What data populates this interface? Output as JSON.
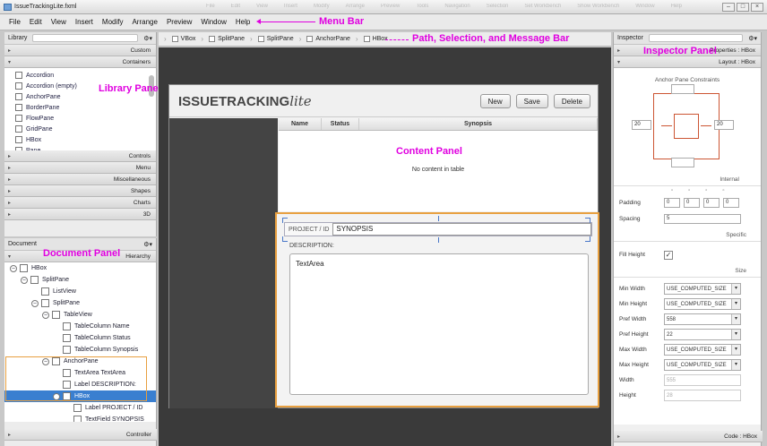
{
  "window": {
    "title": "IssueTrackingLite.fxml",
    "ghost_menu": [
      "File",
      "Edit",
      "View",
      "Insert",
      "Modify",
      "Arrange",
      "Preview",
      "Tools",
      "Navigation",
      "Selection",
      "Set Workbench",
      "Show Workbench",
      "Window",
      "Help"
    ]
  },
  "menu": [
    "File",
    "Edit",
    "View",
    "Insert",
    "Modify",
    "Arrange",
    "Preview",
    "Window",
    "Help"
  ],
  "callouts": {
    "menu_bar": "Menu Bar",
    "path_bar": "Path, Selection, and Message Bar",
    "library": "Library Panel",
    "document": "Document Panel",
    "content": "Content Panel",
    "inspector": "Inspector Panel"
  },
  "library": {
    "title": "Library",
    "top_sections": [
      "Custom",
      "Containers"
    ],
    "items": [
      "Accordion",
      "Accordion  (empty)",
      "AnchorPane",
      "BorderPane",
      "FlowPane",
      "GridPane",
      "HBox",
      "Pane"
    ],
    "bottom_sections": [
      "Controls",
      "Menu",
      "Miscellaneous",
      "Shapes",
      "Charts",
      "3D"
    ]
  },
  "document": {
    "title": "Document",
    "section": "Hierarchy",
    "tree": [
      {
        "exp": "-",
        "text": "HBox",
        "indent": 0
      },
      {
        "exp": "-",
        "text": "SplitPane",
        "indent": 1
      },
      {
        "exp": "",
        "text": "ListView",
        "indent": 2
      },
      {
        "exp": "-",
        "text": "SplitPane",
        "indent": 2
      },
      {
        "exp": "-",
        "text": "TableView",
        "indent": 3
      },
      {
        "exp": "",
        "text": "TableColumn  Name",
        "indent": 4
      },
      {
        "exp": "",
        "text": "TableColumn  Status",
        "indent": 4
      },
      {
        "exp": "",
        "text": "TableColumn  Synopsis",
        "indent": 4
      },
      {
        "exp": "-",
        "text": "AnchorPane",
        "indent": 3
      },
      {
        "exp": "",
        "text": "TextArea  TextArea",
        "indent": 4
      },
      {
        "exp": "",
        "text": "Label  DESCRIPTION:",
        "indent": 4
      },
      {
        "exp": "-",
        "text": "HBox",
        "indent": 4
      },
      {
        "exp": "",
        "text": "Label  PROJECT / ID",
        "indent": 5
      },
      {
        "exp": "",
        "text": "TextField  SYNOPSIS",
        "indent": 5
      }
    ],
    "footer": "Controller"
  },
  "breadcrumb": [
    "VBox",
    "SplitPane",
    "SplitPane",
    "AnchorPane",
    "HBox"
  ],
  "app": {
    "title_bold": "ISSUETRACKING",
    "title_light": "lite",
    "buttons": [
      "New",
      "Save",
      "Delete"
    ],
    "columns": [
      "Name",
      "Status",
      "Synopsis"
    ],
    "empty_text": "No content in table",
    "project_label": "PROJECT / ID",
    "synopsis_value": "SYNOPSIS",
    "description_label": "DESCRIPTION:",
    "textarea_value": "TextArea"
  },
  "inspector": {
    "title": "Inspector",
    "properties": "Properties : HBox",
    "layout": "Layout : HBox",
    "anchor_title": "Anchor Pane Constraints",
    "anchor_left": "20",
    "anchor_right": "20",
    "internal": "Internal",
    "padding_label": "Padding",
    "padding": [
      "0",
      "0",
      "0",
      "0"
    ],
    "spacing_label": "Spacing",
    "spacing": "5",
    "specific": "Specific",
    "fill_height_label": "Fill Height",
    "size": "Size",
    "size_rows": [
      {
        "label": "Min Width",
        "value": "USE_COMPUTED_SIZE"
      },
      {
        "label": "Min Height",
        "value": "USE_COMPUTED_SIZE"
      },
      {
        "label": "Pref Width",
        "value": "558"
      },
      {
        "label": "Pref Height",
        "value": "22"
      },
      {
        "label": "Max Width",
        "value": "USE_COMPUTED_SIZE"
      },
      {
        "label": "Max Height",
        "value": "USE_COMPUTED_SIZE"
      },
      {
        "label": "Width",
        "value": "555"
      },
      {
        "label": "Height",
        "value": "28"
      }
    ],
    "footer": "Code : HBox"
  },
  "colors": {
    "accent": "#e000e0",
    "selection": "#3a7fd0",
    "highlight": "#e8a040"
  }
}
